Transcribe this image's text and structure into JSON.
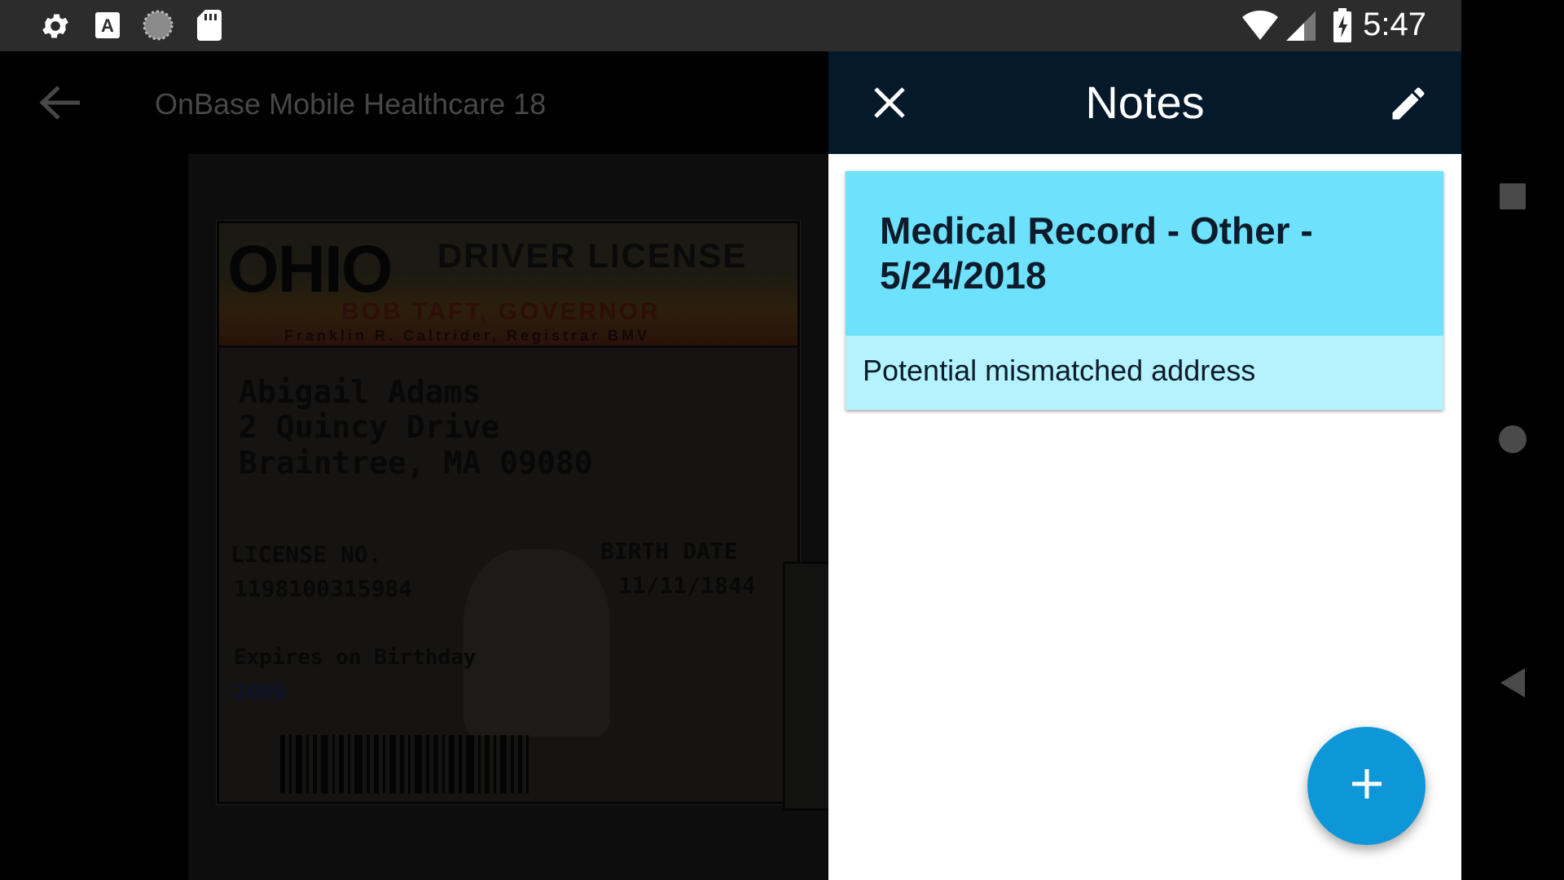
{
  "status_bar": {
    "time": "5:47",
    "left_icons": [
      "gear-icon",
      "font-a-icon",
      "loading-circle-icon",
      "sd-card-icon"
    ],
    "right_icons": [
      "wifi-icon",
      "cell-signal-icon",
      "battery-charging-icon"
    ]
  },
  "app": {
    "title": "OnBase Mobile Healthcare 18",
    "back_icon": "arrow-left-icon"
  },
  "document": {
    "state": "OHIO",
    "type": "DRIVER LICENSE",
    "governor": "BOB TAFT, GOVERNOR",
    "registrar": "Franklin R. Caltrider, Registrar BMV",
    "name": "Abigail Adams",
    "address_line1": "2 Quincy Drive",
    "address_line2": "Braintree, MA 09080",
    "license_no_label": "LICENSE NO.",
    "license_no": "1198100315984",
    "birth_date_label": "BIRTH DATE",
    "birth_date": "11/11/1844",
    "expires_label": "Expires on Birthday",
    "expires_year": "2009"
  },
  "notes": {
    "title": "Notes",
    "close_icon": "close-icon",
    "edit_icon": "pencil-icon",
    "items": [
      {
        "title": "Medical Record - Other - 5/24/2018",
        "text": "Potential mismatched address"
      }
    ],
    "add_icon": "plus-icon"
  },
  "nav_bar": {
    "buttons": [
      "recents-square-icon",
      "home-circle-icon",
      "back-triangle-icon"
    ]
  },
  "colors": {
    "notes_header": "#04192a",
    "note_head": "#6ee2fc",
    "note_body": "#b4f2fd",
    "fab": "#0e97d8",
    "status_bar": "#2c2c2c"
  }
}
